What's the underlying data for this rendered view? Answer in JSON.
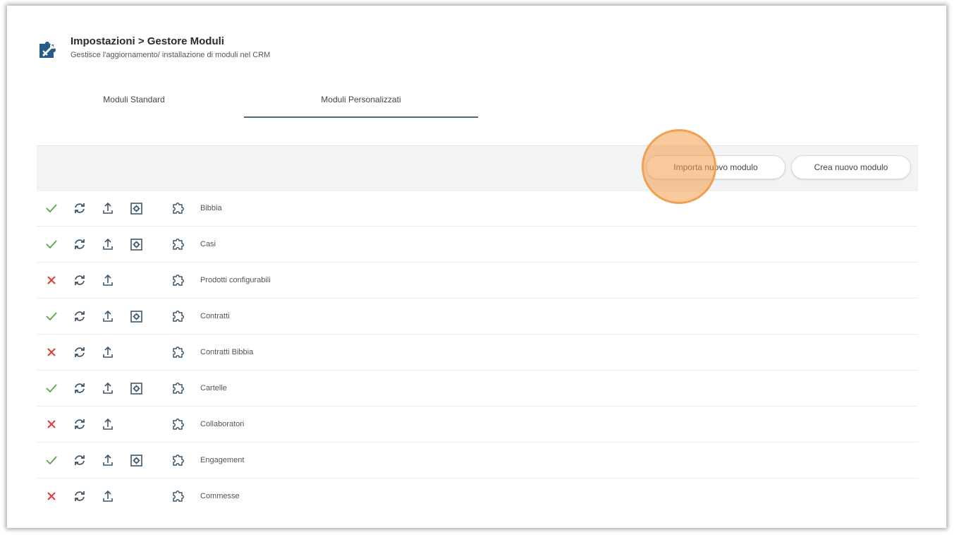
{
  "header": {
    "title": "Impostazioni > Gestore Moduli",
    "subtitle": "Gestisce l'aggiornamento/ installazione di moduli nel CRM"
  },
  "tabs": [
    {
      "label": "Moduli Standard",
      "active": false
    },
    {
      "label": "Moduli Personalizzati",
      "active": true
    }
  ],
  "toolbar": {
    "import_label": "Importa nuovo modulo",
    "create_label": "Crea nuovo modulo"
  },
  "colors": {
    "enabled": "#5aa24a",
    "disabled": "#e03a3a",
    "icon": "#3d566b",
    "highlight": "#f39c48",
    "tab_underline": "#4a6a82"
  },
  "modules": [
    {
      "name": "Bibbia",
      "enabled": true,
      "has_settings": true
    },
    {
      "name": "Casi",
      "enabled": true,
      "has_settings": true
    },
    {
      "name": "Prodotti configurabili",
      "enabled": false,
      "has_settings": false
    },
    {
      "name": "Contratti",
      "enabled": true,
      "has_settings": true
    },
    {
      "name": "Contratti Bibbia",
      "enabled": false,
      "has_settings": false
    },
    {
      "name": "Cartelle",
      "enabled": true,
      "has_settings": true
    },
    {
      "name": "Collaboratori",
      "enabled": false,
      "has_settings": false
    },
    {
      "name": "Engagement",
      "enabled": true,
      "has_settings": true
    },
    {
      "name": "Commesse",
      "enabled": false,
      "has_settings": false
    }
  ]
}
